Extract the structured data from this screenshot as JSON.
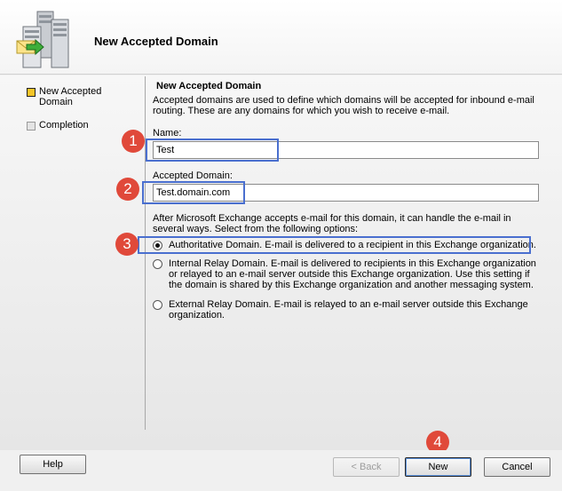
{
  "window": {
    "title": "New Accepted Domain"
  },
  "nav": {
    "items": [
      {
        "label": "New Accepted Domain",
        "state": "active"
      },
      {
        "label": "Completion",
        "state": "inactive"
      }
    ]
  },
  "page": {
    "heading": "New Accepted Domain",
    "description": "Accepted domains are used to define which domains will be accepted for inbound e-mail routing.  These are any domains for which you wish to receive e-mail.",
    "name_label": "Name:",
    "name_value": "Test",
    "domain_label": "Accepted Domain:",
    "domain_value": "Test.domain.com",
    "options_intro": "After Microsoft Exchange accepts e-mail for this domain, it can handle the e-mail in several ways. Select from the following options:",
    "options": [
      {
        "label": "Authoritative Domain. E-mail is delivered to a recipient in this Exchange organization.",
        "checked": true
      },
      {
        "label": "Internal Relay Domain. E-mail is delivered to recipients in this Exchange organization or relayed to an e-mail server outside this Exchange organization. Use this setting if the domain is shared by this Exchange organization and another messaging system.",
        "checked": false
      },
      {
        "label": "External Relay Domain. E-mail is relayed to an e-mail server outside this Exchange organization.",
        "checked": false
      }
    ]
  },
  "annotations": {
    "badges": [
      "1",
      "2",
      "3",
      "4"
    ],
    "badge_color": "#e0493a",
    "highlight_color": "#4a6fcf"
  },
  "buttons": {
    "help": "Help",
    "back": "< Back",
    "next": "New",
    "cancel": "Cancel"
  },
  "colors": {
    "active_step": "#f5c528",
    "default_button_ring": "#5a8fd8"
  }
}
